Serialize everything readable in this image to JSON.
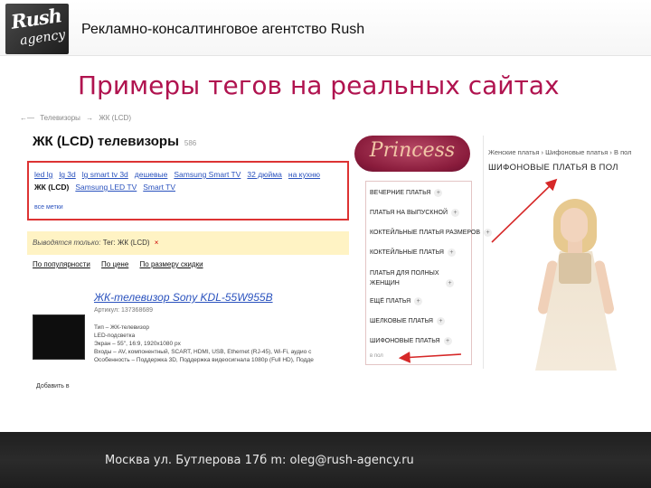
{
  "header": {
    "logo_line1": "Rush",
    "logo_line2": "agency",
    "agency_name": "Рекламно-консалтинговое агентство Rush"
  },
  "title": "Примеры тегов на реальных сайтах",
  "left_shot": {
    "breadcrumb": [
      "Телевизоры",
      "ЖК (LCD)"
    ],
    "page_heading": "ЖК (LCD) телевизоры",
    "product_count": "586",
    "tags_row1": [
      "led lg",
      "lg 3d",
      "lg smart tv 3d",
      "дешевые",
      "Samsung Smart TV",
      "32 дюйма",
      "на кухню"
    ],
    "tags_row2": [
      "ЖК (LCD)",
      "Samsung LED TV",
      "Smart TV"
    ],
    "active_tag": "ЖК (LCD)",
    "all_tags_link": "все метки",
    "filter_label": "Выводятся только:",
    "filter_value": "Тег: ЖК (LCD)",
    "filter_remove": "×",
    "sort_links": [
      "По популярности",
      "По цене",
      "По размеру скидки"
    ],
    "product_title": "ЖК-телевизор Sony KDL-55W955B",
    "article": "Артикул: 137368689",
    "specs": [
      "Тип – ЖК-телевизор",
      "LED-подсветка",
      "Экран – 55\", 16:9, 1920x1080 px",
      "Входы – AV, компонентный, SCART, HDMI, USB, Ethernet (RJ-45), Wi-Fi, аудио с",
      "Особенность – Поддержка 3D, Поддержка видеосигнала 1080p (Full HD), Подде"
    ],
    "add_to_cart": "Добавить в"
  },
  "right_shot": {
    "brand": "Princess",
    "menu_items": [
      "Вечерние платья",
      "Платья на выпускной",
      "Коктейльные платья размеров",
      "Коктейльные платья",
      "Платья для полных женщин",
      "Ещё платья",
      "Шелковые платья",
      "Шифоновые платья"
    ],
    "menu_more": "в пол",
    "breadcrumb": "Женские платья › Шифоновые платья › В пол",
    "heading": "ШИФОНОВЫЕ ПЛАТЬЯ В ПОЛ"
  },
  "colors": {
    "title": "#b0134f",
    "highlight_border": "#d33333",
    "arrow": "#d62828",
    "link": "#2a52be"
  },
  "footer": {
    "contact": "Москва ул. Бутлерова 17б  m: oleg@rush-agency.ru"
  }
}
